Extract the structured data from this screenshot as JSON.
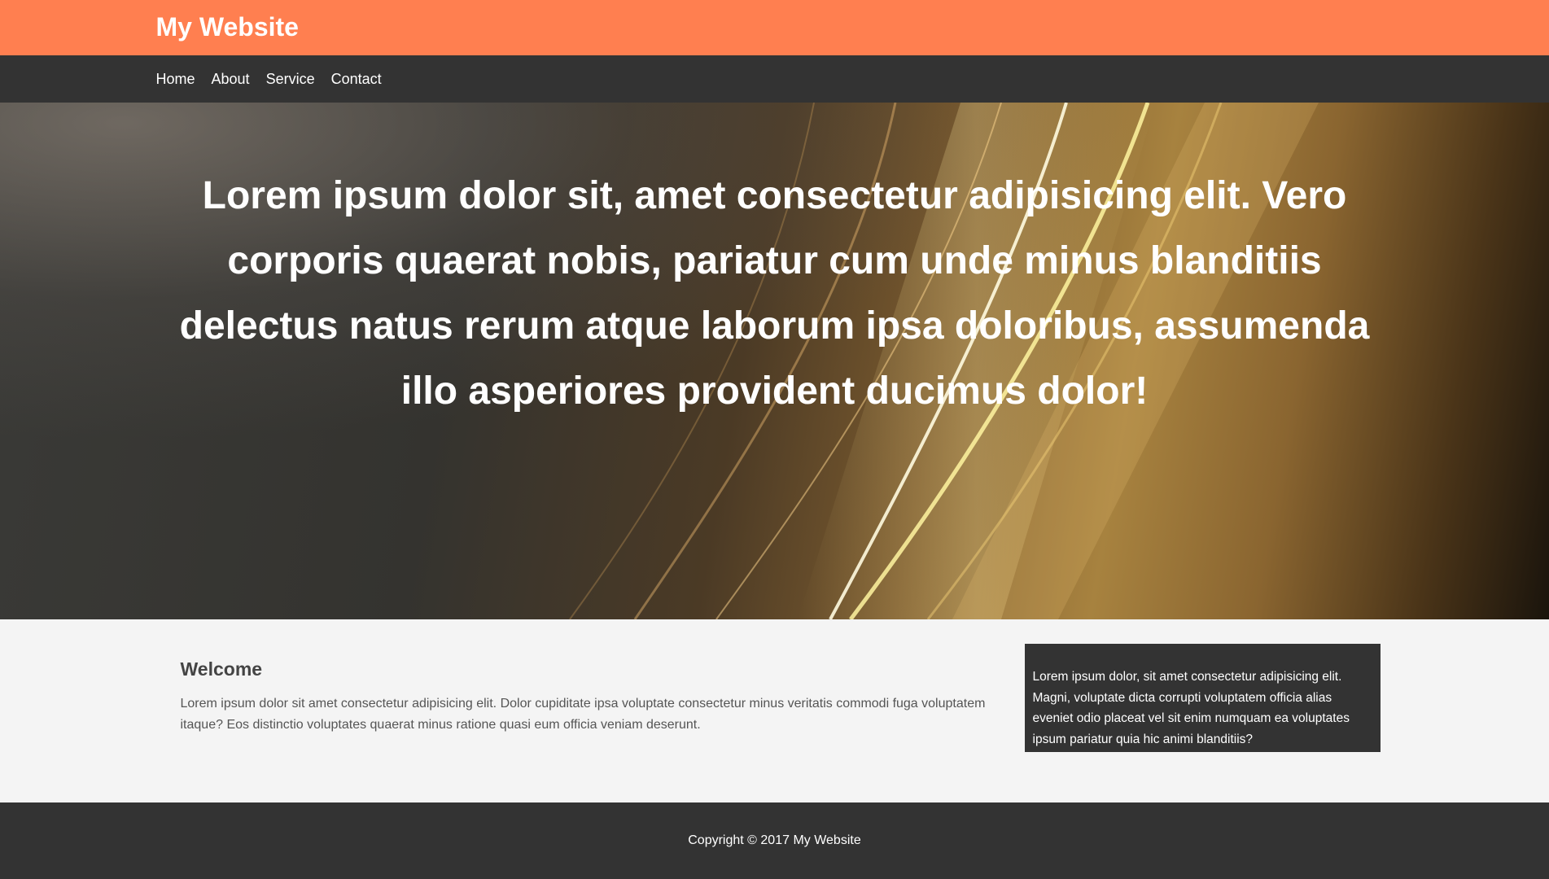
{
  "header": {
    "site_title": "My Website"
  },
  "nav": {
    "items": [
      {
        "label": "Home"
      },
      {
        "label": "About"
      },
      {
        "label": "Service"
      },
      {
        "label": "Contact"
      }
    ]
  },
  "showcase": {
    "heading": "Lorem ipsum dolor sit, amet consectetur adipisicing elit. Vero corporis quaerat nobis, pariatur cum unde minus blanditiis delectus natus rerum atque laborum ipsa doloribus, assumenda illo asperiores provident ducimus dolor!"
  },
  "main": {
    "welcome_title": "Welcome",
    "welcome_text": "Lorem ipsum dolor sit amet consectetur adipisicing elit. Dolor cupiditate ipsa voluptate consectetur minus veritatis commodi fuga voluptatem itaque? Eos distinctio voluptates quaerat minus ratione quasi eum officia veniam deserunt.",
    "sidebar_text": "Lorem ipsum dolor, sit amet consectetur adipisicing elit. Magni, voluptate dicta corrupti voluptatem officia alias eveniet odio placeat vel sit enim numquam ea voluptates ipsum pariatur quia hic animi blanditiis?"
  },
  "footer": {
    "copyright": "Copyright © 2017 My Website"
  },
  "colors": {
    "header_bg": "#ff7f50",
    "nav_bg": "#333333",
    "page_bg": "#f4f4f4",
    "footer_bg": "#333333"
  }
}
